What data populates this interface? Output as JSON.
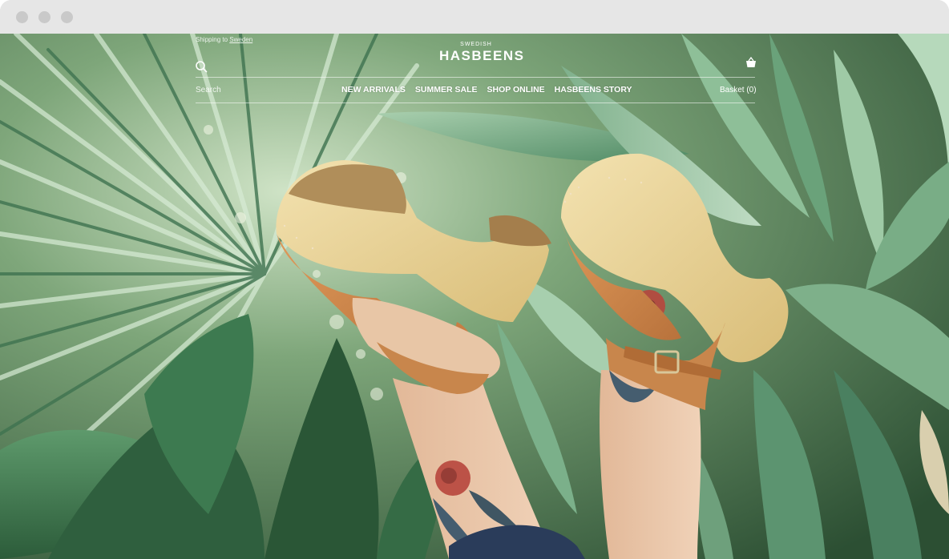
{
  "header": {
    "shipping_prefix": "Shipping to",
    "shipping_country": "Sweden",
    "logo_small": "SWEDISH",
    "logo_big": "HASBEENS",
    "search_placeholder": "Search",
    "basket_label": "Basket (0)"
  },
  "nav": {
    "items": [
      {
        "label": "NEW ARRIVALS"
      },
      {
        "label": "SUMMER SALE"
      },
      {
        "label": "SHOP ONLINE"
      },
      {
        "label": "HASBEENS STORY"
      }
    ]
  },
  "hero": {
    "subject": "legs wearing tan leather clog sandals among agave leaves"
  },
  "colors": {
    "foliage_dark": "#2f5a3a",
    "foliage_light": "#9cc6a2",
    "leather": "#c9844a",
    "wood": "#e9d49a",
    "skin": "#e9c3a3"
  },
  "icons": {
    "search": "search-icon",
    "basket": "basket-icon"
  }
}
